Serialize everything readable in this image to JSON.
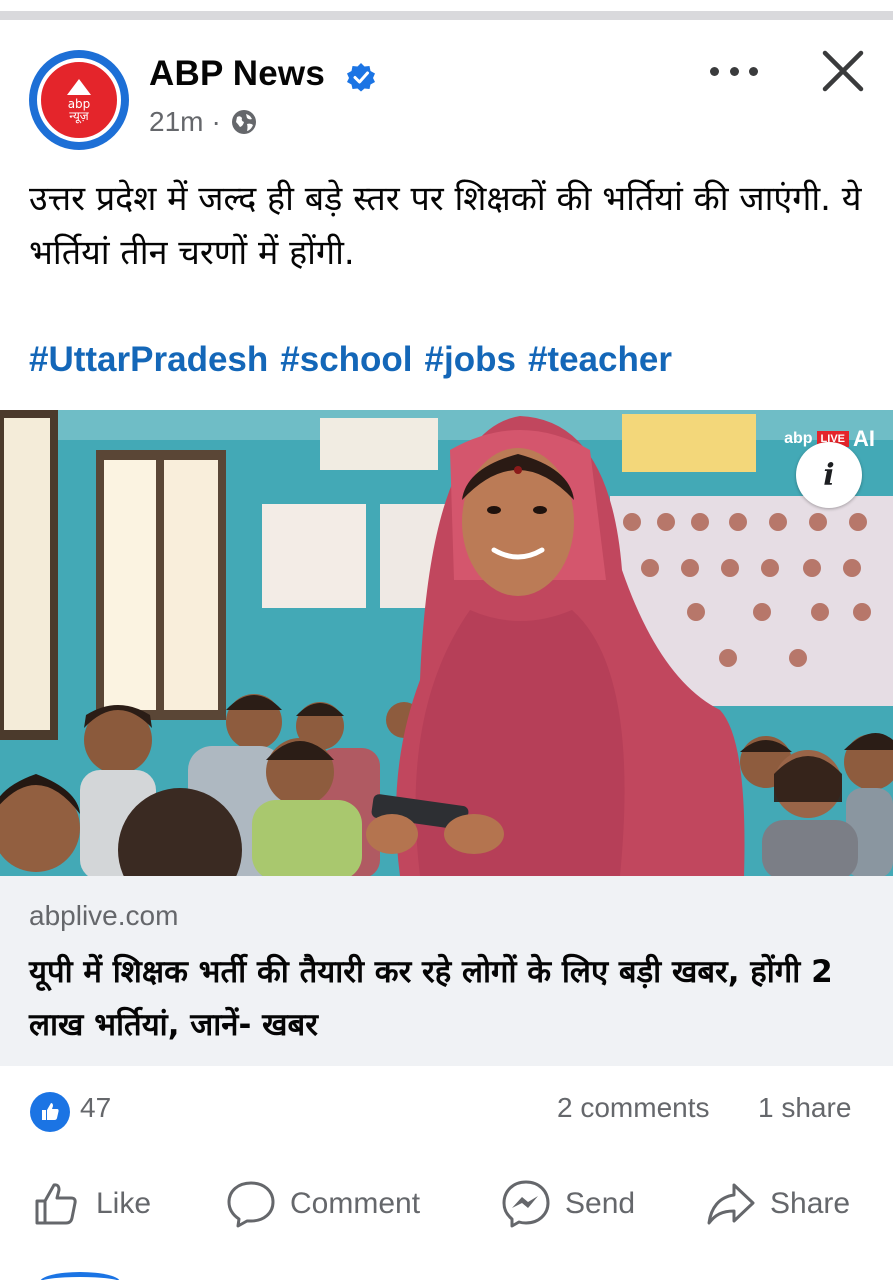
{
  "post": {
    "page_name": "ABP News",
    "time": "21m",
    "separator": "·",
    "avatar_text": "abp\nन्यूज़",
    "text": "उत्तर प्रदेश में जल्द ही बड़े स्तर पर शिक्षकों की भर्तियां की जाएंगी. ये भर्तियां तीन चरणों में होंगी.",
    "hashtags": [
      "#UttarPradesh",
      "#school",
      "#jobs",
      "#teacher"
    ]
  },
  "media": {
    "watermark_brand": "abp",
    "watermark_live": "LIVE",
    "watermark_ai": "AI",
    "info_label": "i"
  },
  "link": {
    "domain": "abplive.com",
    "title": "यूपी में शिक्षक भर्ती की तैयारी कर रहे लोगों के लिए बड़ी खबर, होंगी 2 लाख भर्तियां, जानें- खबर"
  },
  "stats": {
    "likes": "47",
    "comments": "2 comments",
    "shares": "1 share"
  },
  "actions": {
    "like": "Like",
    "comment": "Comment",
    "send": "Send",
    "share": "Share"
  },
  "colors": {
    "brand_red": "#e4252b",
    "hashtag_blue": "#1467b8",
    "like_blue": "#1b74e4",
    "meta_gray": "#65676b"
  },
  "icons": [
    "verified-badge-icon",
    "globe-icon",
    "more-options-icon",
    "close-icon",
    "info-icon",
    "like-reaction-icon",
    "thumbs-up-icon",
    "comment-bubble-icon",
    "messenger-send-icon",
    "share-arrow-icon"
  ]
}
